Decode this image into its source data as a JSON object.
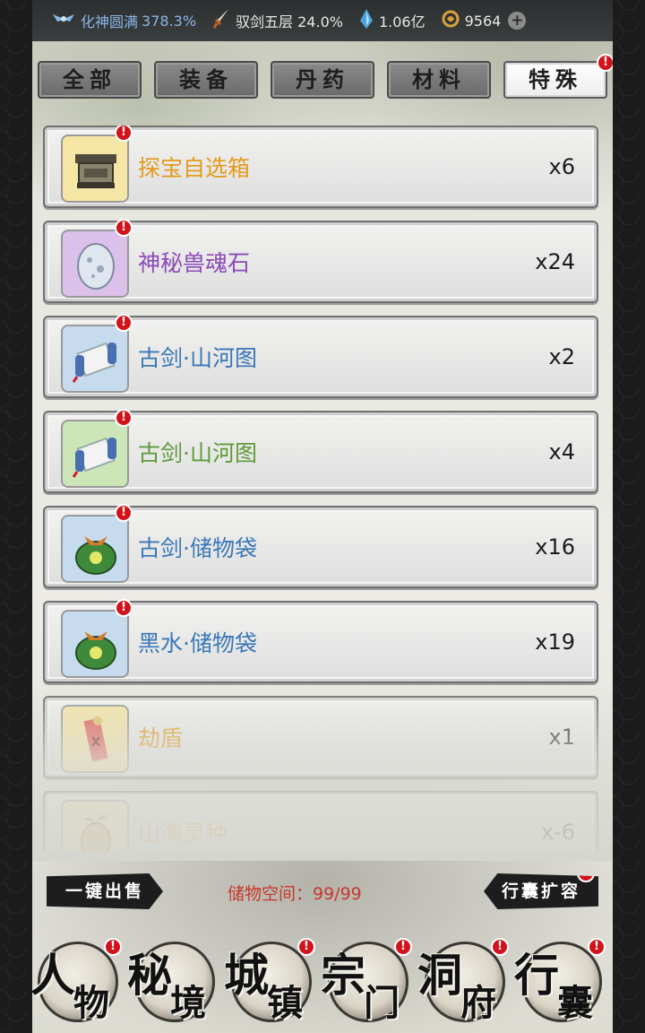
{
  "status": {
    "realm": "化神圆满",
    "realm_pct": "378.3%",
    "sword": "驭剑五层 24.0%",
    "spirit": "1.06亿",
    "coins": "9564"
  },
  "tabs": [
    {
      "label": "全部"
    },
    {
      "label": "装备"
    },
    {
      "label": "丹药"
    },
    {
      "label": "材料"
    },
    {
      "label": "特殊"
    }
  ],
  "active_tab": "特殊",
  "items": [
    {
      "name": "探宝自选箱",
      "qty": "x6",
      "name_color": "#e39a1c",
      "frame": "#f5e6a6",
      "icon": "treasure-chest-icon",
      "alert": true
    },
    {
      "name": "神秘兽魂石",
      "qty": "x24",
      "name_color": "#8a4bb8",
      "frame": "#dbc0ea",
      "icon": "beast-soul-stone-icon",
      "alert": true
    },
    {
      "name": "古剑·山河图",
      "qty": "x2",
      "name_color": "#3a78b8",
      "frame": "#c6dcee",
      "icon": "scroll-icon",
      "alert": true
    },
    {
      "name": "古剑·山河图",
      "qty": "x4",
      "name_color": "#5e9a3a",
      "frame": "#cde6b8",
      "icon": "scroll-icon",
      "alert": true
    },
    {
      "name": "古剑·储物袋",
      "qty": "x16",
      "name_color": "#3a78b8",
      "frame": "#c6dcee",
      "icon": "storage-bag-icon",
      "alert": true
    },
    {
      "name": "黑水·储物袋",
      "qty": "x19",
      "name_color": "#3a78b8",
      "frame": "#c6dcee",
      "icon": "storage-bag-icon",
      "alert": true
    },
    {
      "name": "劫盾",
      "qty": "x1",
      "name_color": "#e39a1c",
      "frame": "#f5e6a6",
      "icon": "talisman-icon",
      "alert": false
    },
    {
      "name": "山海灵种",
      "qty": "x-6",
      "name_color": "#e39a1c",
      "frame": "#f5e6a6",
      "icon": "spirit-seed-icon",
      "alert": false
    }
  ],
  "controls": {
    "sell_all": "一键出售",
    "storage_label": "储物空间：99/99",
    "expand": "行囊扩容"
  },
  "nav": [
    {
      "c1": "人",
      "c2": "物",
      "alert": true
    },
    {
      "c1": "秘",
      "c2": "境",
      "alert": false
    },
    {
      "c1": "城",
      "c2": "镇",
      "alert": true
    },
    {
      "c1": "宗",
      "c2": "门",
      "alert": true
    },
    {
      "c1": "洞",
      "c2": "府",
      "alert": true
    },
    {
      "c1": "行",
      "c2": "囊",
      "alert": true
    }
  ],
  "alert_mark": "!"
}
